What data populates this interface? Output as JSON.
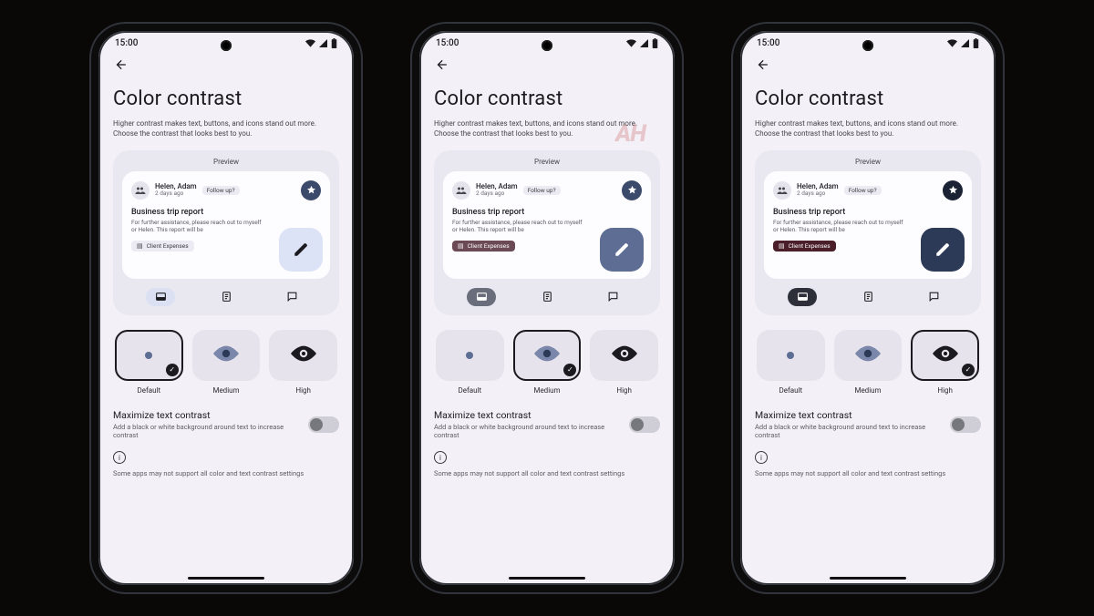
{
  "status": {
    "time": "15:00"
  },
  "page": {
    "title": "Color contrast",
    "subtitle": "Higher contrast makes text, buttons, and icons stand out more. Choose the contrast that looks best to you.",
    "preview_label": "Preview"
  },
  "email": {
    "sender": "Helen, Adam",
    "ago": "2 days ago",
    "follow_chip": "Follow up?",
    "subject": "Business trip report",
    "body": "For further assistance, please reach out to myself or Helen. This report will be",
    "attachment": "Client Expenses"
  },
  "options": {
    "default": "Default",
    "medium": "Medium",
    "high": "High"
  },
  "maximize": {
    "title": "Maximize text contrast",
    "desc": "Add a black or white background around text to increase contrast"
  },
  "note": "Some apps may not support all color and text contrast settings",
  "watermark": "AH",
  "phones": [
    {
      "variant": "default",
      "selected": "default",
      "watermark": false
    },
    {
      "variant": "medium",
      "selected": "medium",
      "watermark": true
    },
    {
      "variant": "high",
      "selected": "high",
      "watermark": false
    }
  ]
}
